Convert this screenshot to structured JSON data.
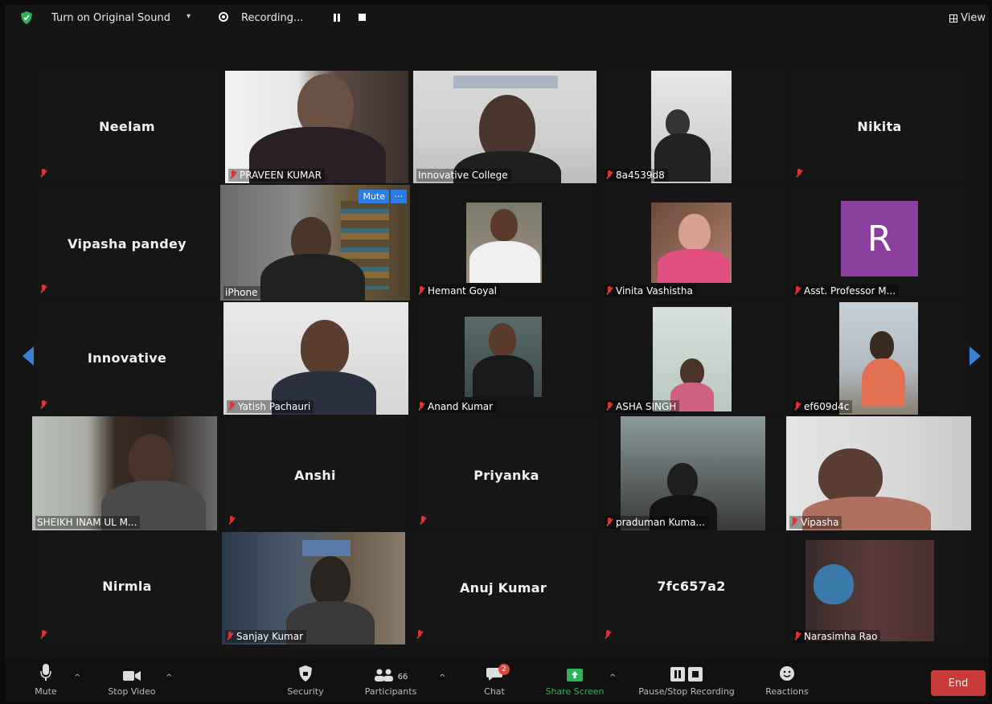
{
  "topbar": {
    "sound_label": "Turn on Original Sound",
    "sound_caret": "▾",
    "recording_label": "Recording...",
    "view_label": "View"
  },
  "participants": [
    {
      "name": "Neelam"
    },
    {
      "name": "PRAVEEN KUMAR"
    },
    {
      "name": "Innovative College"
    },
    {
      "name": "8a4539d8"
    },
    {
      "name": "Nikita"
    },
    {
      "name": "Vipasha pandey"
    },
    {
      "name": "iPhone"
    },
    {
      "name": "Hemant Goyal"
    },
    {
      "name": "Vinita Vashistha"
    },
    {
      "name": "Asst. Professor M..."
    },
    {
      "name": "Innovative"
    },
    {
      "name": "Yatish Pachauri"
    },
    {
      "name": "Anand Kumar"
    },
    {
      "name": "ASHA SINGH"
    },
    {
      "name": "ef609d4c"
    },
    {
      "name": "SHEIKH INAM UL M..."
    },
    {
      "name": "Anshi"
    },
    {
      "name": "Priyanka"
    },
    {
      "name": "praduman Kuma..."
    },
    {
      "name": "Vipasha"
    },
    {
      "name": "Nirmla"
    },
    {
      "name": "Sanjay Kumar"
    },
    {
      "name": "Anuj Kumar"
    },
    {
      "name": "7fc657a2"
    },
    {
      "name": "Narasimha Rao"
    }
  ],
  "tile_controls": {
    "mute_label": "Mute",
    "more_label": "···"
  },
  "avatar_letter": "R",
  "toolbar": {
    "mute": "Mute",
    "stop_video": "Stop Video",
    "security": "Security",
    "participants": "Participants",
    "participant_count": "66",
    "chat": "Chat",
    "chat_badge": "2",
    "share_screen": "Share Screen",
    "pause_stop_recording": "Pause/Stop Recording",
    "reactions": "Reactions",
    "end": "End"
  },
  "colors": {
    "accent_blue": "#2d7be5",
    "active_speaker": "#d8d66a",
    "end_red": "#c93a3a",
    "share_green": "#2fb25a",
    "avatar_purple": "#8a3f9e"
  }
}
